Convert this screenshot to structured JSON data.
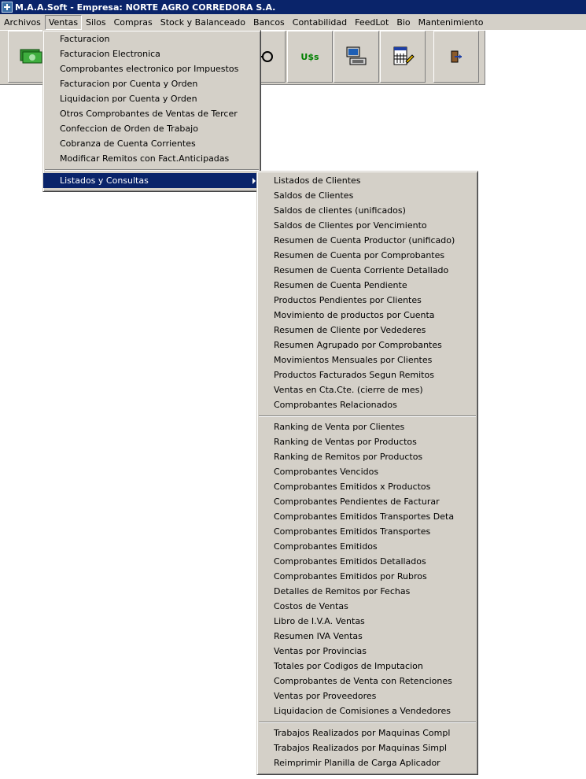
{
  "window": {
    "title": "M.A.A.Soft - Empresa: NORTE AGRO CORREDORA S.A."
  },
  "menubar": [
    "Archivos",
    "Ventas",
    "Silos",
    "Compras",
    "Stock y Balanceado",
    "Bancos",
    "Contabilidad",
    "FeedLot",
    "Bio",
    "Mantenimiento"
  ],
  "toolbar": {
    "usd_label": "U$s"
  },
  "ventas_menu": {
    "items": [
      "Facturacion",
      "Facturacion Electronica",
      "Comprobantes electronico por Impuestos",
      "Facturacion por Cuenta y Orden",
      "Liquidacion por Cuenta y Orden",
      "Otros Comprobantes de Ventas de Tercer",
      "Confeccion de Orden de Trabajo",
      "Cobranza de Cuenta Corrientes",
      "Modificar Remitos con Fact.Anticipadas"
    ],
    "submenu_label": "Listados y Consultas"
  },
  "listados_menu": {
    "group1": [
      "Listados de Clientes",
      "Saldos de Clientes",
      "Saldos de clientes (unificados)",
      "Saldos de Clientes por Vencimiento",
      "Resumen de Cuenta Productor (unificado)",
      "Resumen de Cuenta por Comprobantes",
      "Resumen de Cuenta Corriente Detallado",
      "Resumen de Cuenta Pendiente",
      "Productos Pendientes por Clientes",
      "Movimiento de productos por Cuenta",
      "Resumen de Cliente por Vedederes",
      "Resumen Agrupado por Comprobantes",
      "Movimientos Mensuales por Clientes",
      "Productos Facturados Segun Remitos",
      "Ventas en Cta.Cte. (cierre de mes)",
      "Comprobantes Relacionados"
    ],
    "group2": [
      "Ranking de Venta por Clientes",
      "Ranking de Ventas por Productos",
      "Ranking de Remitos por Productos",
      "Comprobantes Vencidos",
      "Comprobantes Emitidos x Productos",
      "Comprobantes Pendientes de Facturar",
      "Comprobantes Emitidos Transportes Deta",
      "Comprobantes Emitidos Transportes",
      "Comprobantes Emitidos",
      "Comprobantes Emitidos Detallados",
      "Comprobantes Emitidos por Rubros",
      "Detalles de Remitos por Fechas",
      "Costos de Ventas",
      "Libro de I.V.A. Ventas",
      "Resumen IVA Ventas",
      "Ventas por Provincias",
      "Totales por Codigos de Imputacion",
      "Comprobantes de Venta con Retenciones",
      "Ventas por Proveedores",
      "Liquidacion de Comisiones a Vendedores"
    ],
    "group3": [
      "Trabajos Realizados por Maquinas Compl",
      "Trabajos Realizados por Maquinas Simpl",
      "Reimprimir Planilla de Carga Aplicador"
    ]
  },
  "colors": {
    "titlebar": "#0a246a",
    "face": "#d4d0c8",
    "highlight": "#0a246a",
    "usd_green": "#008000"
  },
  "icons": [
    "money-icon",
    "keys-icon",
    "usd-icon",
    "computer-icon",
    "calculator-icon",
    "exit-door-icon"
  ]
}
